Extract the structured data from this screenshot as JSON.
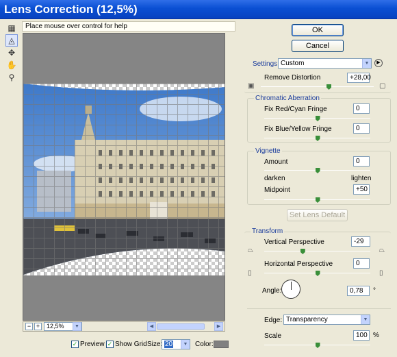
{
  "window": {
    "title": "Lens Correction (12,5%)"
  },
  "help": {
    "text": "Place mouse over control for help"
  },
  "tools": [
    {
      "name": "remove-distortion-tool-icon",
      "glyph": "▦"
    },
    {
      "name": "straighten-tool-icon",
      "glyph": "◬"
    },
    {
      "name": "move-grid-tool-icon",
      "glyph": "✥"
    },
    {
      "name": "hand-tool-icon",
      "glyph": "✋"
    },
    {
      "name": "zoom-tool-icon",
      "glyph": "⚲"
    }
  ],
  "preview_area": {
    "zoom": "12,5%",
    "minus": "−",
    "plus": "+"
  },
  "buttons": {
    "ok": "OK",
    "cancel": "Cancel",
    "set_lens_default": "Set Lens Default"
  },
  "settings": {
    "label": "Settings:",
    "value": "Custom"
  },
  "remove_distortion": {
    "label": "Remove Distortion",
    "value": "+28,00",
    "level": 0.6
  },
  "chromatic": {
    "title": "Chromatic Aberration",
    "red_cyan": {
      "label": "Fix Red/Cyan Fringe",
      "value": "0",
      "level": 0.5
    },
    "blue_yellow": {
      "label": "Fix Blue/Yellow Fringe",
      "value": "0",
      "level": 0.5
    }
  },
  "vignette": {
    "title": "Vignette",
    "amount": {
      "label": "Amount",
      "value": "0",
      "level": 0.5
    },
    "darken": "darken",
    "lighten": "lighten",
    "midpoint": {
      "label": "Midpoint",
      "value": "+50",
      "level": 0.5
    }
  },
  "transform": {
    "title": "Transform",
    "vertical": {
      "label": "Vertical Perspective",
      "value": "-29",
      "level": 0.36
    },
    "horizontal": {
      "label": "Horizontal Perspective",
      "value": "0",
      "level": 0.5
    },
    "angle": {
      "label": "Angle:",
      "value": "0,78",
      "unit": "°"
    },
    "edge": {
      "label": "Edge:",
      "value": "Transparency"
    },
    "scale": {
      "label": "Scale",
      "value": "100",
      "unit": "%",
      "level": 0.5
    }
  },
  "footer": {
    "preview": {
      "label": "Preview",
      "checked": true
    },
    "show_grid": {
      "label": "Show Grid",
      "checked": true
    },
    "size": {
      "label": "Size:",
      "value": "20"
    },
    "color": {
      "label": "Color:",
      "swatch": "#808080"
    }
  },
  "colors": {
    "title_bar": "#0a4fd3",
    "group_title": "#1a3c9c",
    "slider_thumb": "#3a8f3a"
  }
}
